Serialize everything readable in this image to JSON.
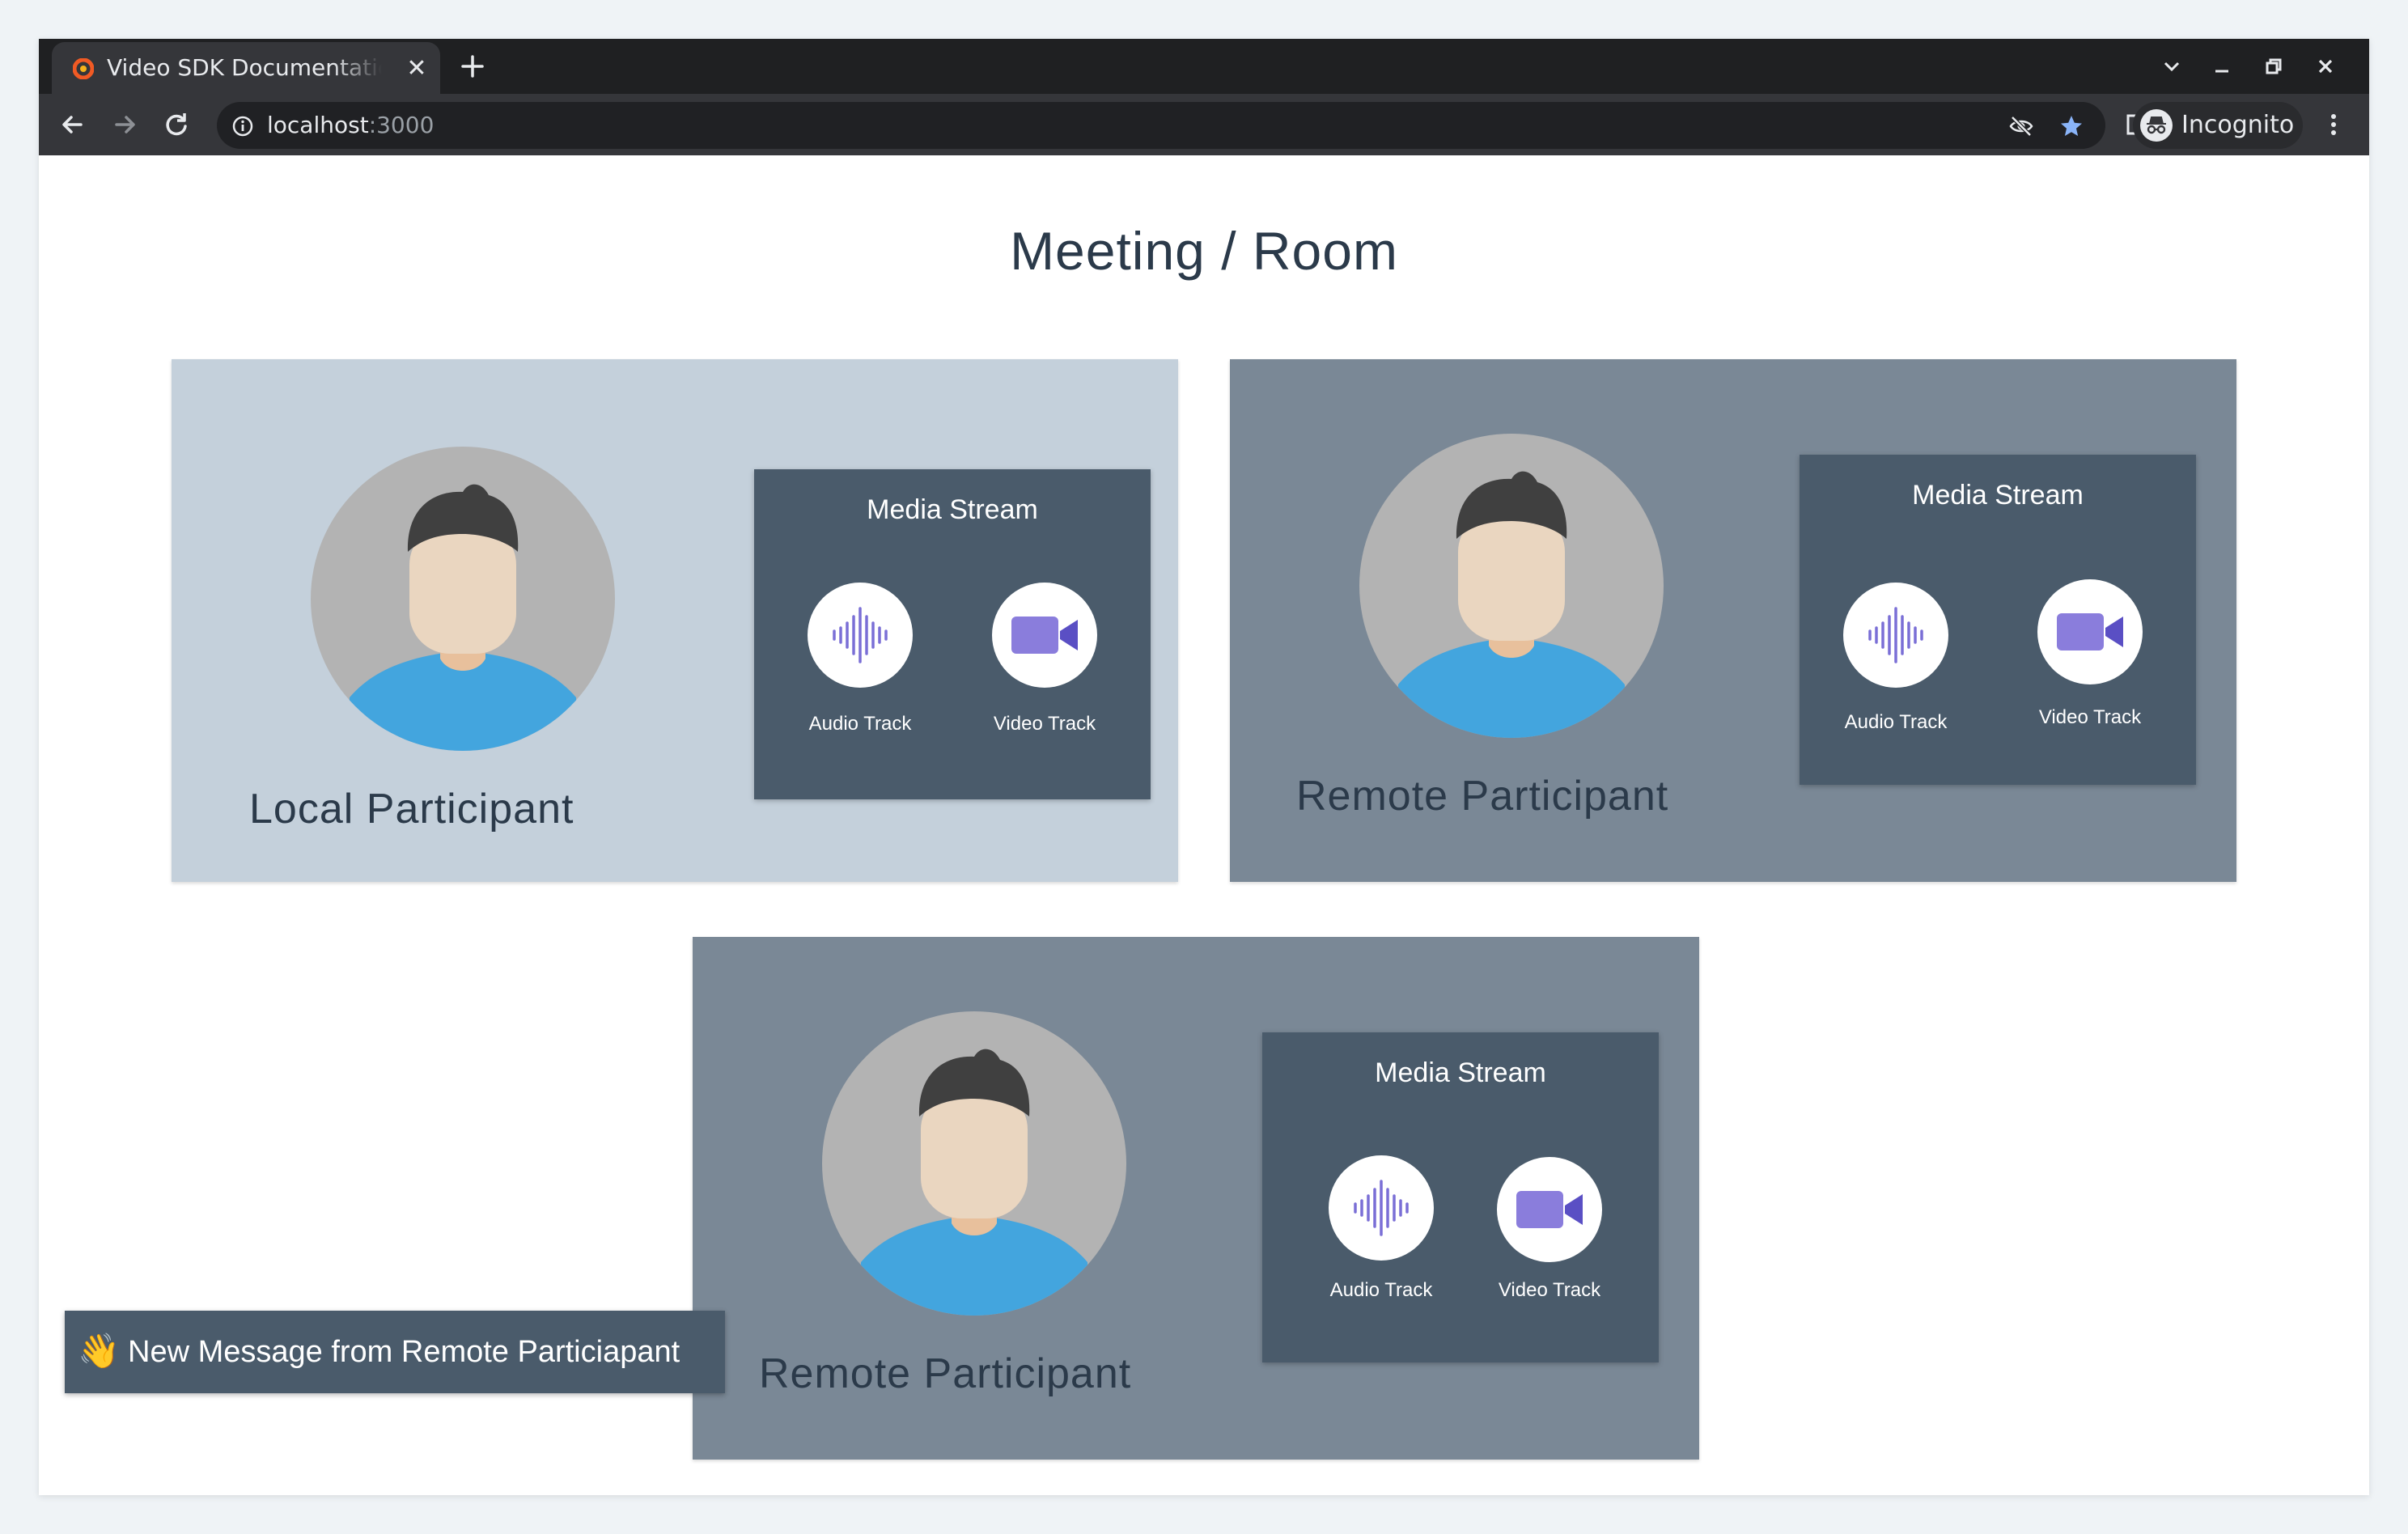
{
  "browser": {
    "tab_title": "Video SDK Documentation",
    "url_host": "localhost",
    "url_port": ":3000",
    "incognito_label": "Incognito",
    "colors": {
      "frame": "#1f2022",
      "toolbar": "#35363a",
      "star": "#8ab4f8"
    }
  },
  "page": {
    "title": "Meeting / Room"
  },
  "participants": [
    {
      "name": "Local Participant",
      "media_title": "Media Stream",
      "audio_label": "Audio Track",
      "video_label": "Video Track",
      "card_color": "#c4d0db"
    },
    {
      "name": "Remote Participant",
      "media_title": "Media Stream",
      "audio_label": "Audio Track",
      "video_label": "Video Track",
      "card_color": "#7a8896"
    },
    {
      "name": "Remote Participant",
      "media_title": "Media Stream",
      "audio_label": "Audio Track",
      "video_label": "Video Track",
      "card_color": "#7a8896"
    }
  ],
  "toast": {
    "emoji": "👋",
    "message": "New Message from Remote Particiapant"
  },
  "icons": {
    "avatar": "person-avatar-icon",
    "audio": "audio-waveform-icon",
    "video": "video-camera-icon"
  }
}
